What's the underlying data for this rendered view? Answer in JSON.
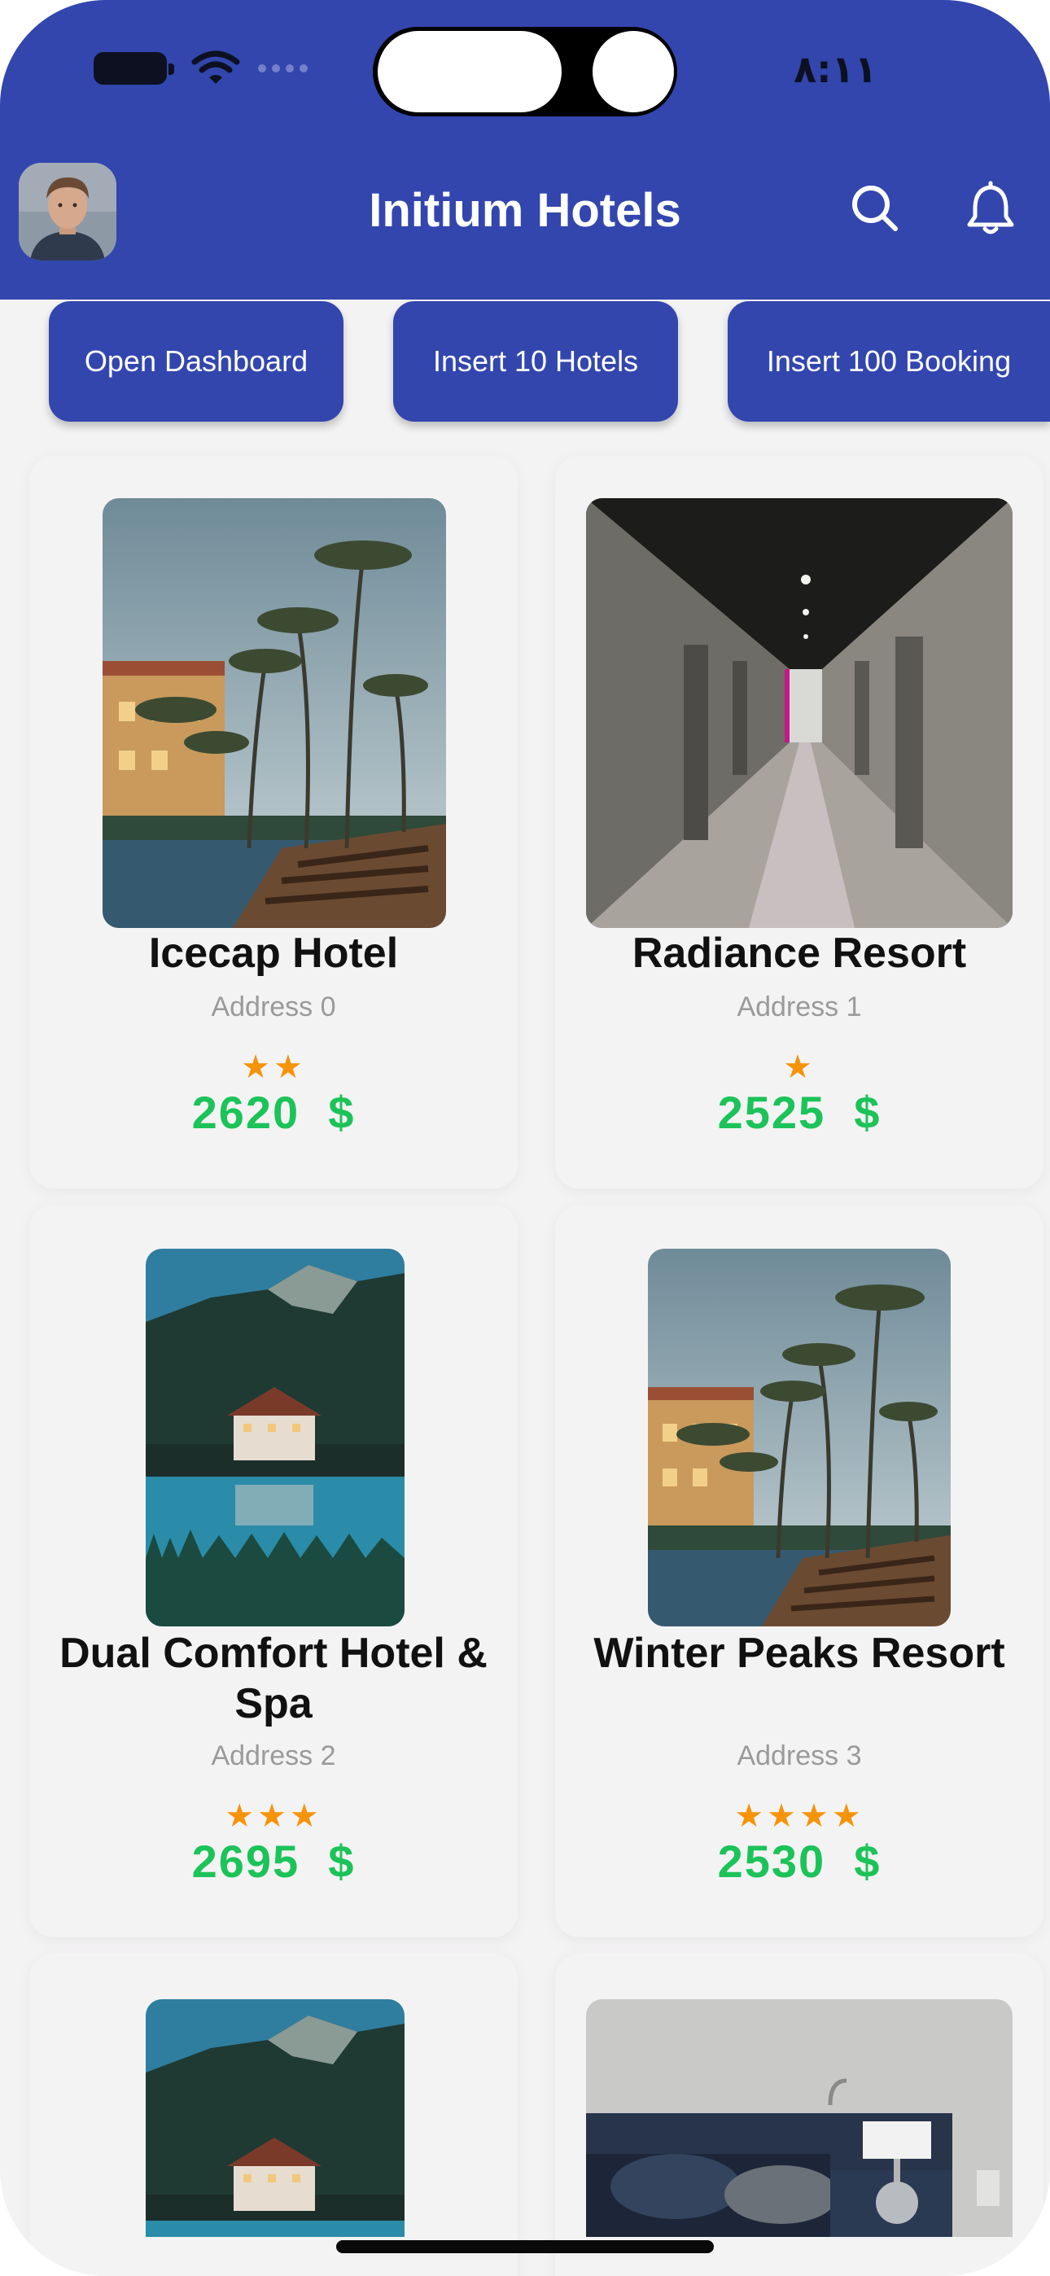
{
  "status_bar": {
    "time": "٨:١١"
  },
  "header": {
    "title": "Initium Hotels"
  },
  "actions": {
    "open_dashboard": "Open Dashboard",
    "insert_hotels": "Insert 10 Hotels",
    "insert_bookings": "Insert 100 Booking"
  },
  "hotels": [
    {
      "name": "Icecap Hotel",
      "address": "Address 0",
      "rating": 2,
      "stars": "★★",
      "price": "2620",
      "currency": "$"
    },
    {
      "name": "Radiance Resort",
      "address": "Address 1",
      "rating": 1,
      "stars": "★",
      "price": "2525",
      "currency": "$"
    },
    {
      "name": "Dual Comfort Hotel & Spa",
      "address": "Address 2",
      "rating": 3,
      "stars": "★★★",
      "price": "2695",
      "currency": "$"
    },
    {
      "name": "Winter Peaks Resort",
      "address": "Address 3",
      "rating": 4,
      "stars": "★★★★",
      "price": "2530",
      "currency": "$"
    }
  ],
  "colors": {
    "primary": "#3346ae",
    "price": "#1bc358",
    "star": "#f5930a",
    "background": "#f4f3f4"
  }
}
